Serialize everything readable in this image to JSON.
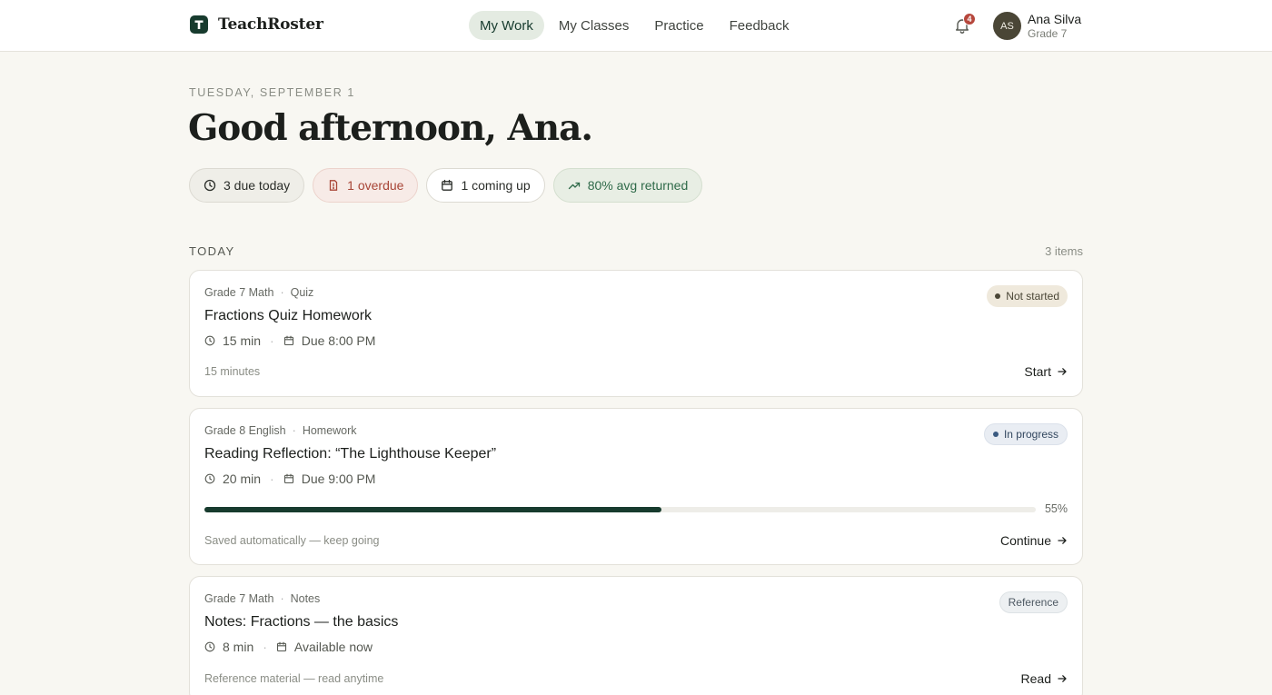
{
  "app": {
    "name": "TeachRoster"
  },
  "nav": [
    {
      "label": "My Work",
      "active": true
    },
    {
      "label": "My Classes",
      "active": false
    },
    {
      "label": "Practice",
      "active": false
    },
    {
      "label": "Feedback",
      "active": false
    }
  ],
  "notifications": {
    "count": "4"
  },
  "user": {
    "initials": "AS",
    "name": "Ana Silva",
    "grade": "Grade 7"
  },
  "greeting": {
    "date": "TUESDAY, SEPTEMBER 1",
    "text": "Good afternoon, Ana."
  },
  "chips": {
    "due_today": "3 due today",
    "overdue": "1 overdue",
    "coming_up": "1 coming up",
    "avg_returned": "80% avg returned"
  },
  "section": {
    "label": "TODAY",
    "count": "3 items"
  },
  "items": [
    {
      "course": "Grade 7 Math",
      "type": "Quiz",
      "title": "Fractions Quiz Homework",
      "duration": "15 min",
      "due": "Due 8:00 PM",
      "status": "Not started",
      "footnote": "15 minutes",
      "action": "Start"
    },
    {
      "course": "Grade 8 English",
      "type": "Homework",
      "title": "Reading Reflection: “The Lighthouse Keeper”",
      "duration": "20 min",
      "due": "Due 9:00 PM",
      "status": "In progress",
      "progress": 0.55,
      "progress_label": "55%",
      "footnote": "Saved automatically — keep going",
      "action": "Continue"
    },
    {
      "course": "Grade 7 Math",
      "type": "Notes",
      "title": "Notes: Fractions — the basics",
      "duration": "8 min",
      "due": "Available now",
      "status": "Reference",
      "footnote": "Reference material — read anytime",
      "action": "Read"
    }
  ],
  "colors": {
    "brand": "#173b2e",
    "overdue": "#a84537",
    "positive": "#2f6a49",
    "badge": "#b6473c"
  }
}
